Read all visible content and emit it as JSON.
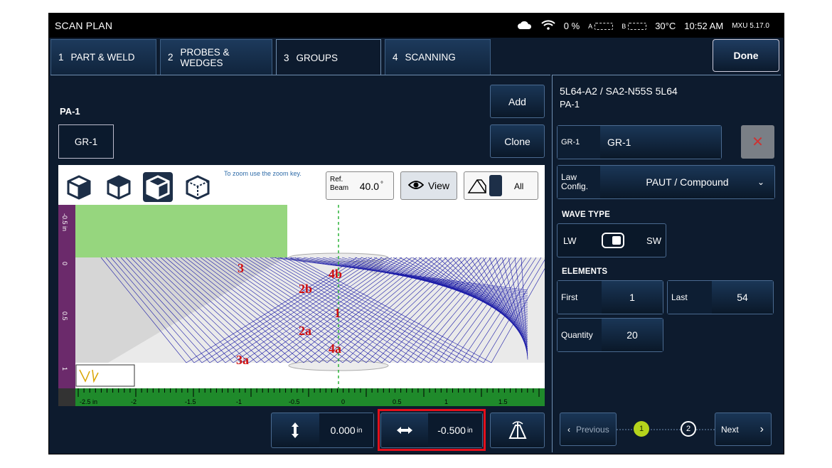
{
  "app": {
    "title": "SCAN PLAN"
  },
  "status": {
    "battery_pct": "0 %",
    "battery_a": "A",
    "battery_b": "B",
    "temperature": "30°C",
    "time": "10:52 AM",
    "version": "MXU 5.17.0"
  },
  "tabs": [
    {
      "num": "1",
      "label": "PART & WELD"
    },
    {
      "num": "2",
      "label": "PROBES & WEDGES"
    },
    {
      "num": "3",
      "label": "GROUPS"
    },
    {
      "num": "4",
      "label": "SCANNING"
    }
  ],
  "done_label": "Done",
  "left": {
    "pa_label": "PA-1",
    "group_button": "GR-1",
    "add_label": "Add",
    "clone_label": "Clone"
  },
  "viewer": {
    "zoom_hint": "To zoom use the zoom key.",
    "ref_beam_label_1": "Ref.",
    "ref_beam_label_2": "Beam",
    "ref_beam_value": "40.0",
    "ref_beam_unit": "°",
    "view_label": "View",
    "all_label": "All",
    "vruler": [
      "-0.5 in",
      "0",
      "0.5",
      "1"
    ],
    "hruler": [
      "-2.5 in",
      "-2",
      "-1.5",
      "-1",
      "-0.5",
      "0",
      "0.5",
      "1",
      "1.5"
    ],
    "weld_labels": [
      "3",
      "4b",
      "2b",
      "1",
      "2a",
      "4a",
      "3a"
    ],
    "legend_dash": "--"
  },
  "bottom": {
    "vertical_offset": "0.000",
    "vertical_unit": "in",
    "horizontal_offset": "-0.500",
    "horizontal_unit": "in"
  },
  "right": {
    "probe": "5L64-A2 / SA2-N55S 5L64",
    "probe_sub": "PA-1",
    "group_field_label": "GR-1",
    "group_field_value": "GR-1",
    "law_label_1": "Law",
    "law_label_2": "Config.",
    "law_value": "PAUT / Compound",
    "wave_type_title": "WAVE TYPE",
    "wave_left": "LW",
    "wave_right": "SW",
    "elements_title": "ELEMENTS",
    "first_label": "First",
    "first_value": "1",
    "last_label": "Last",
    "last_value": "54",
    "quantity_label": "Quantity",
    "quantity_value": "20",
    "previous_label": "Previous",
    "next_label": "Next",
    "page1": "1",
    "page2": "2"
  },
  "colors": {
    "accent": "#0d1b2e",
    "highlight": "#e3101b",
    "ruler_green": "#1f8a2b",
    "beam_blue": "#1a1aa6",
    "label_red": "#d01010",
    "page_active": "#b5d41c"
  }
}
